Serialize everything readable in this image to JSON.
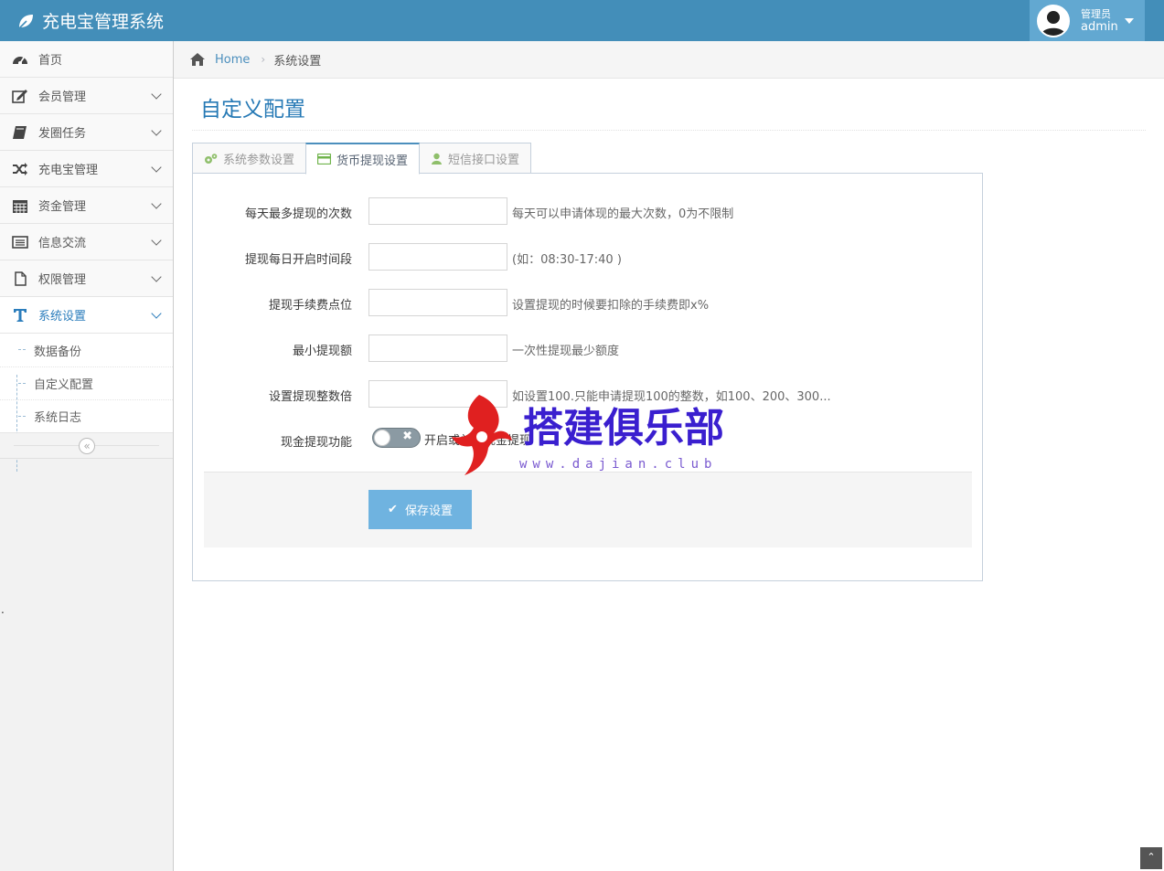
{
  "app": {
    "title": "充电宝管理系统"
  },
  "user": {
    "role": "管理员",
    "name": "admin"
  },
  "sidebar": {
    "items": [
      {
        "label": "首页",
        "icon": "dashboard-icon"
      },
      {
        "label": "会员管理",
        "icon": "edit-icon"
      },
      {
        "label": "发圈任务",
        "icon": "book-icon"
      },
      {
        "label": "充电宝管理",
        "icon": "shuffle-icon"
      },
      {
        "label": "资金管理",
        "icon": "calendar-icon"
      },
      {
        "label": "信息交流",
        "icon": "list-icon"
      },
      {
        "label": "权限管理",
        "icon": "file-icon"
      },
      {
        "label": "系统设置",
        "icon": "text-icon"
      }
    ],
    "sub_items": [
      "数据备份",
      "自定义配置",
      "系统日志"
    ],
    "collapse_glyph": "«"
  },
  "breadcrumb": {
    "home": "Home",
    "current": "系统设置",
    "separator": "›"
  },
  "page": {
    "title": "自定义配置"
  },
  "tabs": [
    {
      "label": "系统参数设置",
      "icon": "cogs-icon",
      "color": "#8fbf6b"
    },
    {
      "label": "货币提现设置",
      "icon": "credit-card-icon",
      "color": "#6fb34b"
    },
    {
      "label": "短信接口设置",
      "icon": "user-icon",
      "color": "#8fbf6b"
    }
  ],
  "form": {
    "rows": [
      {
        "label": "每天最多提现的次数",
        "value": "",
        "help": "每天可以申请体现的最大次数，0为不限制"
      },
      {
        "label": "提现每日开启时间段",
        "value": "",
        "help": "(如：08:30-17:40 )"
      },
      {
        "label": "提现手续费点位",
        "value": "",
        "help": "设置提现的时候要扣除的手续费即x%"
      },
      {
        "label": "最小提现额",
        "value": "",
        "help": "一次性提现最少额度"
      },
      {
        "label": "设置提现整数倍",
        "value": "",
        "help": "如设置100.只能申请提现100的整数，如100、200、300..."
      }
    ],
    "switch": {
      "label": "现金提现功能",
      "text": "开启或关闭现金提现",
      "state": "off",
      "off_glyph": "✖"
    },
    "save_label": "保存设置",
    "save_glyph": "✔"
  },
  "watermark": {
    "text": "搭建俱乐部",
    "url": "www.dajian.club"
  },
  "misc": {
    "scroll_top_glyph": "⌃",
    "stray_mark": "."
  },
  "colors": {
    "navbar": "#438eb9",
    "accent": "#2679b5",
    "button": "#6fb3e0"
  }
}
